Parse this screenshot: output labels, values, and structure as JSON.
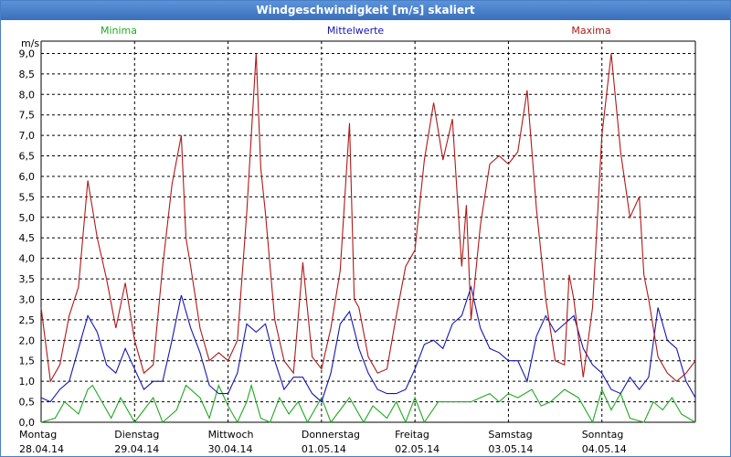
{
  "window": {
    "title": "Windgeschwindigkeit [m/s] skaliert"
  },
  "chart_data": {
    "type": "line",
    "title": "Windgeschwindigkeit [m/s] skaliert",
    "ylabel": "m/s",
    "xlabel": "",
    "ylim": [
      0,
      9.3
    ],
    "xlim": [
      0,
      7
    ],
    "yticks": [
      0,
      0.5,
      1,
      1.5,
      2,
      2.5,
      3,
      3.5,
      4,
      4.5,
      5,
      5.5,
      6,
      6.5,
      7,
      7.5,
      8,
      8.5,
      9
    ],
    "ytick_labels": [
      "0,0",
      "0,5",
      "1,0",
      "1,5",
      "2,0",
      "2,5",
      "3,0",
      "3,5",
      "4,0",
      "4,5",
      "5,0",
      "5,5",
      "6,0",
      "6,5",
      "7,0",
      "7,5",
      "8,0",
      "8,5",
      "9,0"
    ],
    "x_ticks": [
      {
        "day": "Montag",
        "date": "28.04.14"
      },
      {
        "day": "Dienstag",
        "date": "29.04.14"
      },
      {
        "day": "Mittwoch",
        "date": "30.04.14"
      },
      {
        "day": "Donnerstag",
        "date": "01.05.14"
      },
      {
        "day": "Freitag",
        "date": "02.05.14"
      },
      {
        "day": "Samstag",
        "date": "03.05.14"
      },
      {
        "day": "Sonntag",
        "date": "04.05.14"
      }
    ],
    "grid": true,
    "legend_placement": "top",
    "series": [
      {
        "name": "Minima",
        "color": "#1fa81f",
        "x": [
          0,
          0.15,
          0.25,
          0.4,
          0.5,
          0.55,
          0.65,
          0.75,
          0.85,
          1.0,
          1.1,
          1.2,
          1.3,
          1.45,
          1.55,
          1.7,
          1.8,
          1.9,
          2.0,
          2.1,
          2.2,
          2.25,
          2.35,
          2.45,
          2.55,
          2.65,
          2.75,
          2.85,
          3.0,
          3.1,
          3.2,
          3.3,
          3.45,
          3.55,
          3.7,
          3.8,
          3.9,
          4.0,
          4.1,
          4.25,
          4.4,
          4.6,
          4.7,
          4.8,
          4.9,
          5.0,
          5.1,
          5.25,
          5.35,
          5.45,
          5.6,
          5.75,
          5.9,
          6.0,
          6.1,
          6.2,
          6.3,
          6.45,
          6.55,
          6.65,
          6.75,
          6.85,
          7.0
        ],
        "values": [
          0,
          0.1,
          0.5,
          0.2,
          0.8,
          0.9,
          0.5,
          0.1,
          0.6,
          0,
          0.3,
          0.6,
          0,
          0.3,
          0.9,
          0.6,
          0.1,
          0.9,
          0.4,
          0,
          0.5,
          0.9,
          0.1,
          0,
          0.6,
          0.2,
          0.5,
          0,
          0.6,
          0,
          0.3,
          0.6,
          0,
          0.4,
          0.1,
          0.5,
          0,
          0.6,
          0,
          0.5,
          0.5,
          0.5,
          0.6,
          0.7,
          0.5,
          0.7,
          0.6,
          0.8,
          0.4,
          0.5,
          0.8,
          0.6,
          0,
          0.8,
          0.3,
          0.7,
          0.1,
          0,
          0.5,
          0.3,
          0.6,
          0.2,
          0
        ]
      },
      {
        "name": "Mittelwerte",
        "color": "#1616b0",
        "x": [
          0,
          0.1,
          0.2,
          0.3,
          0.4,
          0.5,
          0.6,
          0.7,
          0.8,
          0.9,
          1.0,
          1.1,
          1.2,
          1.3,
          1.4,
          1.5,
          1.6,
          1.7,
          1.8,
          1.9,
          2.0,
          2.1,
          2.2,
          2.3,
          2.4,
          2.5,
          2.6,
          2.7,
          2.8,
          2.9,
          3.0,
          3.1,
          3.2,
          3.3,
          3.4,
          3.5,
          3.6,
          3.7,
          3.8,
          3.9,
          4.0,
          4.1,
          4.2,
          4.3,
          4.4,
          4.5,
          4.6,
          4.7,
          4.8,
          4.9,
          5.0,
          5.1,
          5.2,
          5.3,
          5.4,
          5.5,
          5.6,
          5.7,
          5.8,
          5.9,
          6.0,
          6.1,
          6.2,
          6.3,
          6.4,
          6.5,
          6.6,
          6.7,
          6.8,
          6.9,
          7.0
        ],
        "values": [
          0.6,
          0.5,
          0.8,
          1.0,
          1.8,
          2.6,
          2.2,
          1.4,
          1.2,
          1.8,
          1.3,
          0.8,
          1.0,
          1.0,
          2.0,
          3.1,
          2.3,
          1.7,
          0.9,
          0.7,
          0.7,
          1.2,
          2.4,
          2.2,
          2.4,
          1.5,
          0.8,
          1.1,
          1.1,
          0.7,
          0.5,
          1.2,
          2.4,
          2.7,
          1.8,
          1.2,
          0.8,
          0.7,
          0.7,
          0.8,
          1.3,
          1.9,
          2.0,
          1.8,
          2.4,
          2.6,
          3.3,
          2.3,
          1.8,
          1.7,
          1.5,
          1.5,
          1.0,
          2.1,
          2.6,
          2.2,
          2.4,
          2.6,
          1.8,
          1.4,
          1.2,
          0.8,
          0.7,
          1.1,
          0.8,
          1.1,
          2.8,
          2.0,
          1.8,
          1.0,
          0.6
        ]
      },
      {
        "name": "Maxima",
        "color": "#b01818",
        "x": [
          0,
          0.1,
          0.2,
          0.3,
          0.4,
          0.5,
          0.55,
          0.6,
          0.7,
          0.8,
          0.9,
          1.0,
          1.1,
          1.2,
          1.3,
          1.4,
          1.5,
          1.55,
          1.6,
          1.7,
          1.8,
          1.9,
          2.0,
          2.1,
          2.2,
          2.3,
          2.35,
          2.4,
          2.5,
          2.6,
          2.7,
          2.8,
          2.9,
          3.0,
          3.1,
          3.2,
          3.3,
          3.35,
          3.4,
          3.5,
          3.6,
          3.7,
          3.8,
          3.9,
          4.0,
          4.1,
          4.2,
          4.3,
          4.4,
          4.5,
          4.55,
          4.6,
          4.7,
          4.8,
          4.9,
          5.0,
          5.1,
          5.2,
          5.3,
          5.4,
          5.5,
          5.6,
          5.65,
          5.7,
          5.8,
          5.9,
          6.0,
          6.1,
          6.2,
          6.3,
          6.4,
          6.45,
          6.5,
          6.6,
          6.7,
          6.8,
          6.9,
          7.0
        ],
        "values": [
          2.8,
          1.0,
          1.4,
          2.6,
          3.3,
          5.9,
          5.2,
          4.5,
          3.5,
          2.3,
          3.4,
          2.0,
          1.2,
          1.4,
          3.8,
          5.8,
          7.0,
          4.5,
          3.8,
          2.3,
          1.5,
          1.7,
          1.5,
          2.0,
          5.1,
          9.0,
          6.2,
          5.1,
          2.5,
          1.5,
          1.2,
          3.9,
          1.6,
          1.3,
          2.3,
          3.7,
          7.3,
          3.0,
          2.8,
          1.6,
          1.2,
          1.3,
          2.6,
          3.8,
          4.2,
          6.4,
          7.8,
          6.4,
          7.4,
          3.8,
          5.3,
          2.5,
          4.8,
          6.3,
          6.5,
          6.3,
          6.6,
          8.1,
          5.2,
          3.0,
          1.5,
          1.4,
          3.6,
          3.0,
          1.1,
          2.8,
          7.0,
          9.0,
          6.6,
          5.0,
          5.5,
          3.6,
          3.0,
          1.6,
          1.2,
          1.0,
          1.2,
          1.5
        ]
      }
    ]
  }
}
